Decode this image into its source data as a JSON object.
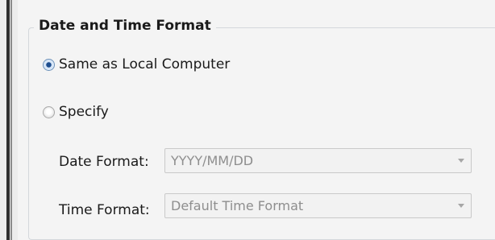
{
  "group": {
    "title": "Date and Time Format"
  },
  "options": {
    "same_as_local": {
      "label": "Same as Local Computer",
      "selected": true
    },
    "specify": {
      "label": "Specify",
      "selected": false
    }
  },
  "date_format": {
    "label": "Date Format:",
    "value": "YYYY/MM/DD",
    "enabled": false
  },
  "time_format": {
    "label": "Time Format:",
    "value": "Default Time Format",
    "enabled": false
  },
  "colors": {
    "accent": "#1d4d8f",
    "disabled_text": "#8e8e8e"
  }
}
